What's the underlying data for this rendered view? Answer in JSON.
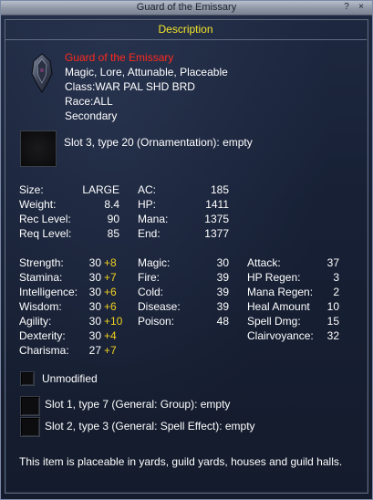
{
  "window": {
    "title": "Guard of the Emissary",
    "help": "?",
    "close": "×"
  },
  "header": {
    "label": "Description"
  },
  "item": {
    "name": "Guard of the Emissary",
    "flags": "Magic, Lore, Attunable, Placeable",
    "class": "Class:WAR PAL SHD BRD",
    "race": "Race:ALL",
    "slot": "Secondary",
    "icon": "shield-icon"
  },
  "aug_slot": {
    "label": "Slot 3, type 20 (Ornamentation): empty"
  },
  "basic": [
    {
      "label": "Size:",
      "value": "LARGE"
    },
    {
      "label": "Weight:",
      "value": "8.4"
    },
    {
      "label": "Rec Level:",
      "value": "90"
    },
    {
      "label": "Req Level:",
      "value": "85"
    }
  ],
  "defense": [
    {
      "label": "AC:",
      "value": "185"
    },
    {
      "label": "HP:",
      "value": "1411"
    },
    {
      "label": "Mana:",
      "value": "1375"
    },
    {
      "label": "End:",
      "value": "1377"
    }
  ],
  "attributes": [
    {
      "label": "Strength:",
      "value": "30",
      "bonus": "+8"
    },
    {
      "label": "Stamina:",
      "value": "30",
      "bonus": "+7"
    },
    {
      "label": "Intelligence:",
      "value": "30",
      "bonus": "+6"
    },
    {
      "label": "Wisdom:",
      "value": "30",
      "bonus": "+6"
    },
    {
      "label": "Agility:",
      "value": "30",
      "bonus": "+10"
    },
    {
      "label": "Dexterity:",
      "value": "30",
      "bonus": "+4"
    },
    {
      "label": "Charisma:",
      "value": "27",
      "bonus": "+7"
    }
  ],
  "resists": [
    {
      "label": "Magic:",
      "value": "30"
    },
    {
      "label": "Fire:",
      "value": "39"
    },
    {
      "label": "Cold:",
      "value": "39"
    },
    {
      "label": "Disease:",
      "value": "39"
    },
    {
      "label": "Poison:",
      "value": "48"
    }
  ],
  "mods": [
    {
      "label": "Attack:",
      "value": "37"
    },
    {
      "label": "HP Regen:",
      "value": "3"
    },
    {
      "label": "Mana Regen:",
      "value": "2"
    },
    {
      "label": "Heal Amount",
      "value": "10"
    },
    {
      "label": "Spell Dmg:",
      "value": "15"
    },
    {
      "label": "Clairvoyance:",
      "value": "32"
    }
  ],
  "status": {
    "label": "Unmodified"
  },
  "aug_slots": [
    {
      "label": "Slot 1, type 7 (General: Group): empty"
    },
    {
      "label": "Slot 2, type 3 (General: Spell Effect): empty"
    }
  ],
  "footer": {
    "text": "This item is placeable in yards, guild yards, houses and guild halls."
  },
  "colors": {
    "name": "#ff2a1e",
    "header": "#f5e62a",
    "bonus": "#f0d020"
  }
}
